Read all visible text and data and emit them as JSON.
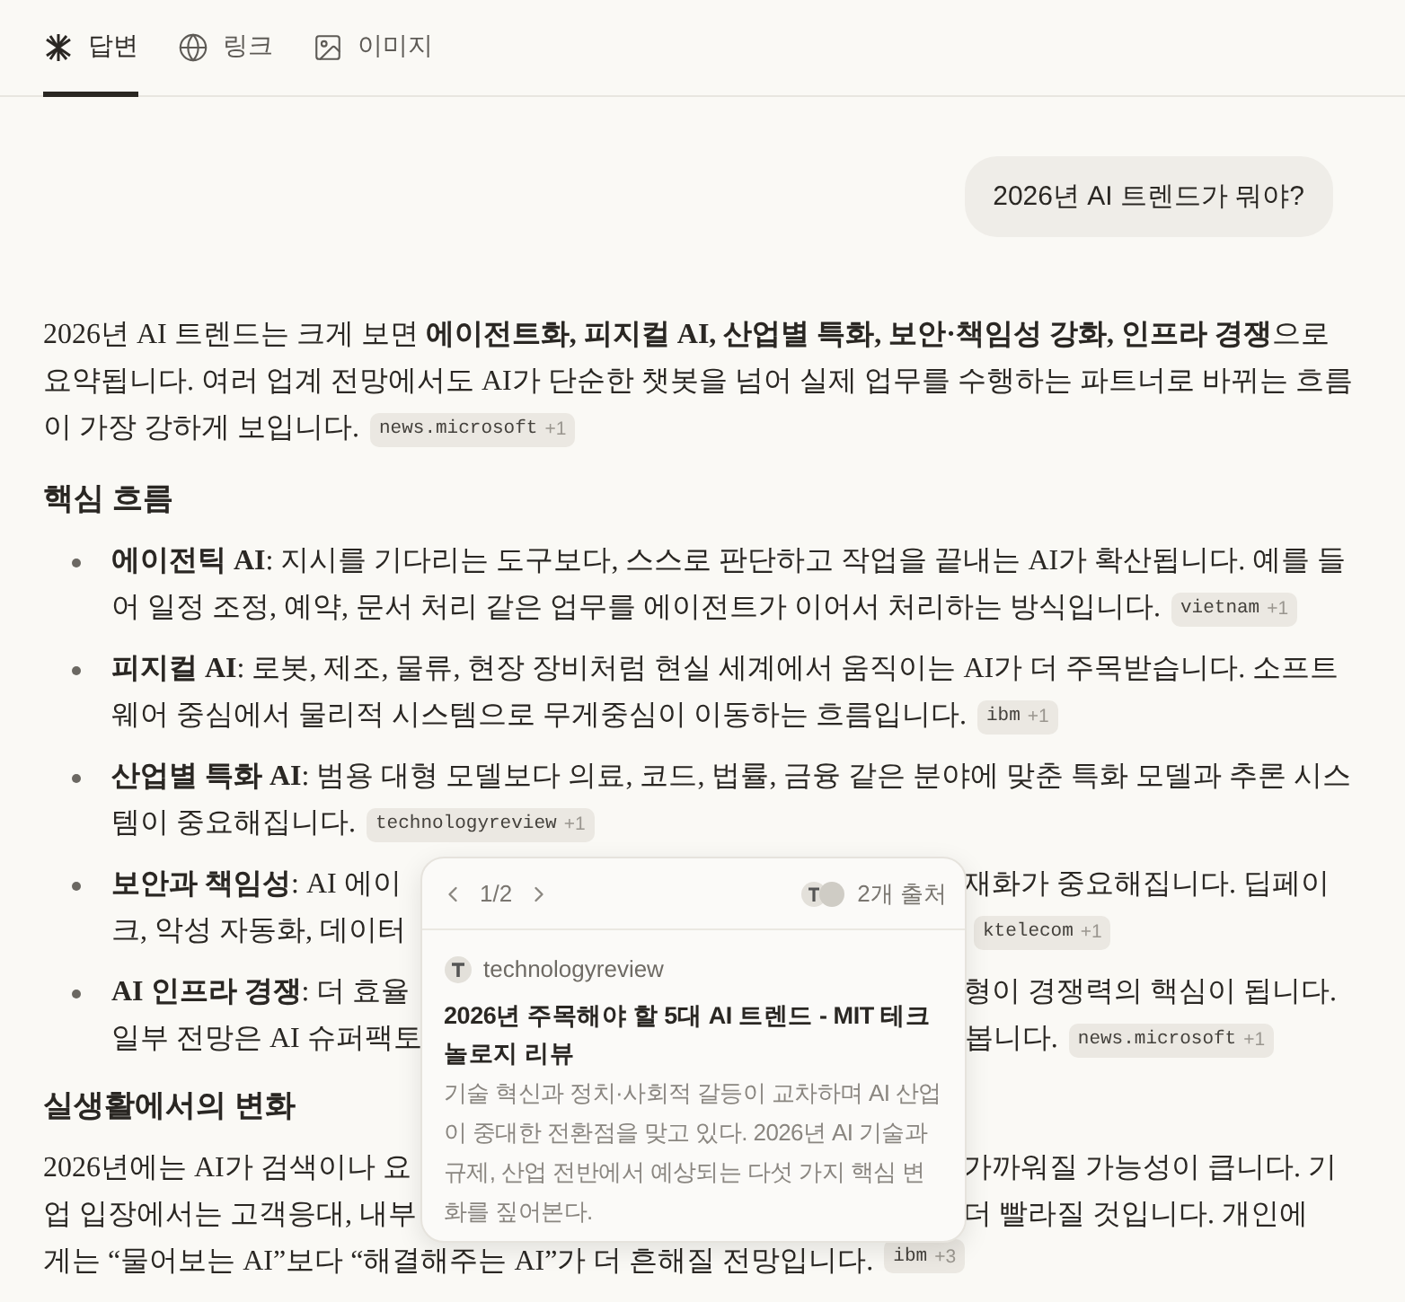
{
  "tabs": [
    {
      "label": "답변",
      "selected": true
    },
    {
      "label": "링크",
      "selected": false
    },
    {
      "label": "이미지",
      "selected": false
    }
  ],
  "user_message": "2026년 AI 트렌드가 뭐야?",
  "answer": [
    {
      "kind": "paragraph",
      "text": "2026년 AI 트렌드는 크게 보면 **에이전트화, 피지컬 AI, 산업별 특화, 보안·책임성 강화, 인프라 경쟁**으로 요약됩니다. 여러 업계 전망에서도 AI가 단순한 챗봇을 넘어 실제 업무를 수행하는 파트너로 바뀌는 흐름이 가장 강하게 보입니다.",
      "citation": {
        "source": "news.microsoft",
        "more": "+1"
      }
    },
    {
      "kind": "heading",
      "text": "핵심 흐름"
    },
    {
      "kind": "list",
      "items": [
        {
          "text": "**에이전틱 AI**: 지시를 기다리는 도구보다, 스스로 판단하고 작업을 끝내는 AI가 확산됩니다. 예를 들어 일정 조정, 예약, 문서 처리 같은 업무를 에이전트가 이어서 처리하는 방식입니다.",
          "citation": {
            "source": "vietnam",
            "more": "+1"
          }
        },
        {
          "text": "**피지컬 AI**: 로봇, 제조, 물류, 현장 장비처럼 현실 세계에서 움직이는 AI가 더 주목받습니다. 소프트웨어 중심에서 물리적 시스템으로 무게중심이 이동하는 흐름입니다.",
          "citation": {
            "source": "ibm",
            "more": "+1"
          }
        },
        {
          "text": "**산업별 특화 AI**: 범용 대형 모델보다 의료, 코드, 법률, 금융 같은 분야에 맞춘 특화 모델과 추론 시스템이 중요해집니다.",
          "citation": {
            "source": "technologyreview",
            "more": "+1"
          }
        },
        {
          "lines": [
            {
              "left": "**보안과 책임성**: AI 에이",
              "right": "재화가 중요해집니다. 딥페이"
            },
            {
              "left": "크, 악성 자동화, 데이터",
              "citation": {
                "source": "ktelecom",
                "more": "+1"
              }
            }
          ]
        },
        {
          "lines": [
            {
              "left": "**AI 인프라 경쟁**: 더 효율",
              "right": "형이 경쟁력의 핵심이 됩니다."
            },
            {
              "left": "일부 전망은 AI 슈퍼팩토",
              "right": "봅니다.",
              "citation": {
                "source": "news.microsoft",
                "more": "+1"
              }
            }
          ]
        }
      ]
    },
    {
      "kind": "heading",
      "text": "실생활에서의 변화"
    },
    {
      "kind": "paragraph",
      "lines": [
        {
          "left": "2026년에는 AI가 검색이나 요",
          "right": "가까워질 가능성이 큽니다. 기"
        },
        {
          "left": "업 입장에서는 고객응대, 내부",
          "right": "더 빨라질 것입니다. 개인에"
        },
        {
          "full": "게는 “물어보는 AI”보다 “해결해주는 AI”가 더 흔해질 전망입니다.",
          "citation": {
            "source": "ibm",
            "more": "+3"
          }
        }
      ]
    }
  ],
  "popover": {
    "pager": "1/2",
    "sources_count": "2개 출처",
    "source": "technologyreview",
    "title": "2026년 주목해야 할 5대 AI 트렌드 - MIT 테크놀로지 리뷰",
    "description": "기술 혁신과 정치·사회적 갈등이 교차하며 AI 산업이 중대한 전환점을 맞고 있다. 2026년 AI 기술과 규제, 산업 전반에서 예상되는 다섯 가지 핵심 변화를 짚어본다."
  }
}
